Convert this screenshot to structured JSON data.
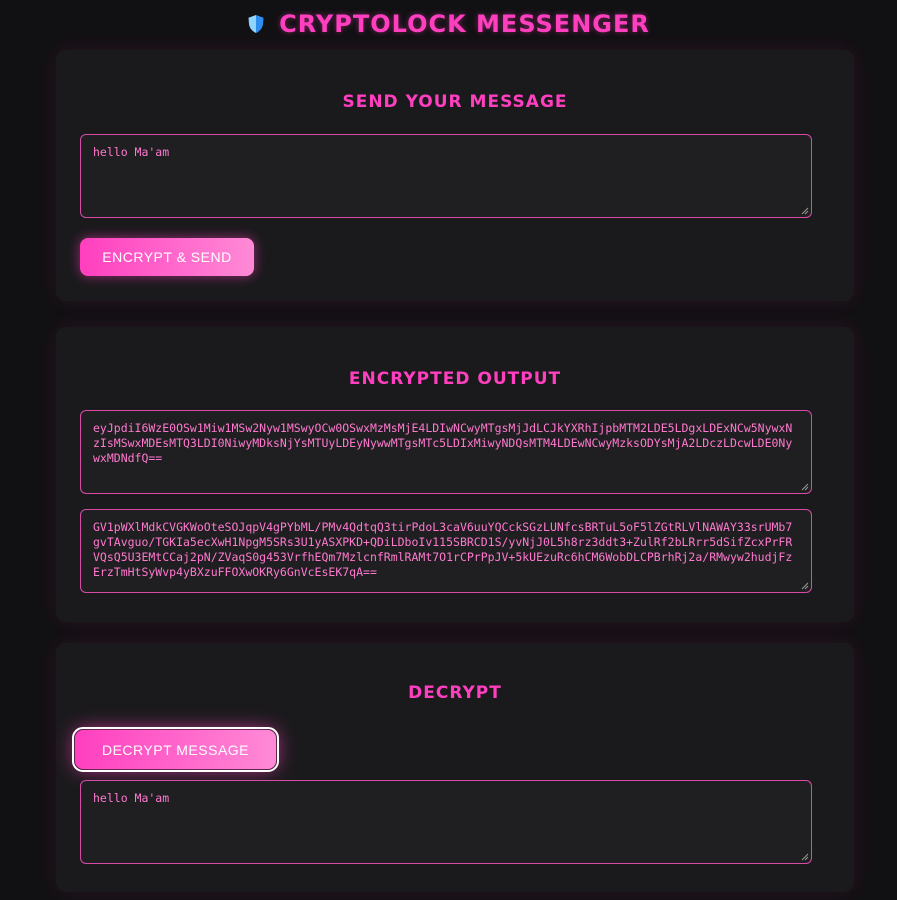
{
  "header": {
    "title": "CRYPTOLOCK MESSENGER",
    "icon": "shield-icon"
  },
  "send_panel": {
    "heading": "SEND YOUR MESSAGE",
    "message_value": "hello Ma'am",
    "button_label": "ENCRYPT & SEND"
  },
  "output_panel": {
    "heading": "ENCRYPTED OUTPUT",
    "output_1": "eyJpdiI6WzE0OSw1Miw1MSw2Nyw1MSwyOCw0OSwxMzMsMjE4LDIwNCwyMTgsMjJdLCJkYXRhIjpbMTM2LDE5LDgxLDExNCw5NywxNzIsMSwxMDEsMTQ3LDI0NiwyMDksNjYsMTUyLDEyNywwMTgsMTc5LDIxMiwyNDQsMTM4LDEwNCwyMzksODYsMjA2LDczLDcwLDE0NywxMDNdfQ==",
    "output_2": "GV1pWXlMdkCVGKWoOteSOJqpV4gPYbML/PMv4QdtqQ3tirPdoL3caV6uuYQCckSGzLUNfcsBRTuL5oF5lZGtRLVlNAWAY33srUMb7gvTAvguo/TGKIa5ecXwH1NpgM5SRs3U1yASXPKD+QDiLDboIv115SBRCD1S/yvNjJ0L5h8rz3ddt3+ZulRf2bLRrr5dSifZcxPrFRVQsQ5U3EMtCCaj2pN/ZVaqS0g453VrfhEQm7MzlcnfRmlRAMt7O1rCPrPpJV+5kUEzuRc6hCM6WobDLCPBrhRj2a/RMwyw2hudjFzErzTmHtSyWvp4yBXzuFFOXwOKRy6GnVcEsEK7qA=="
  },
  "decrypt_panel": {
    "heading": "DECRYPT",
    "button_label": "DECRYPT MESSAGE",
    "result_value": "hello Ma'am"
  },
  "colors": {
    "accent": "#ff3fbf",
    "background": "#111113",
    "panel": "#1a1a1c",
    "field_border": "#d84aa8"
  }
}
